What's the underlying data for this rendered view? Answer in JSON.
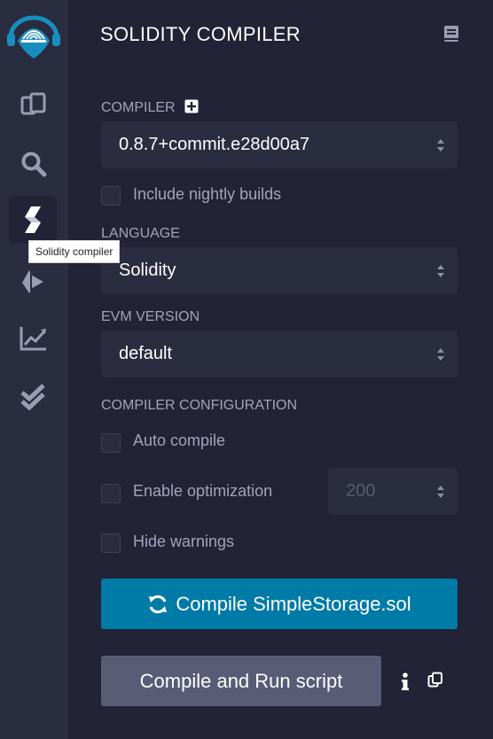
{
  "sidebar": {
    "tooltip": "Solidity compiler",
    "icons": [
      "remix-logo-icon",
      "file-explorer-icon",
      "search-icon",
      "solidity-compiler-icon",
      "deploy-run-icon",
      "analysis-icon",
      "unit-testing-icon"
    ]
  },
  "panel": {
    "title": "SOLIDITY COMPILER",
    "compiler_label": "COMPILER",
    "compiler_version": "0.8.7+commit.e28d00a7",
    "nightly_label": "Include nightly builds",
    "language_label": "LANGUAGE",
    "language_value": "Solidity",
    "evm_label": "EVM VERSION",
    "evm_value": "default",
    "config_label": "COMPILER CONFIGURATION",
    "auto_compile_label": "Auto compile",
    "optimization_label": "Enable optimization",
    "runs_value": "200",
    "hide_warnings_label": "Hide warnings",
    "compile_button": "Compile SimpleStorage.sol",
    "run_script_button": "Compile and Run script"
  },
  "colors": {
    "accent": "#007aa6",
    "background": "#222336",
    "sidebar": "#2a2c3f",
    "secondary_button": "#595c76"
  }
}
